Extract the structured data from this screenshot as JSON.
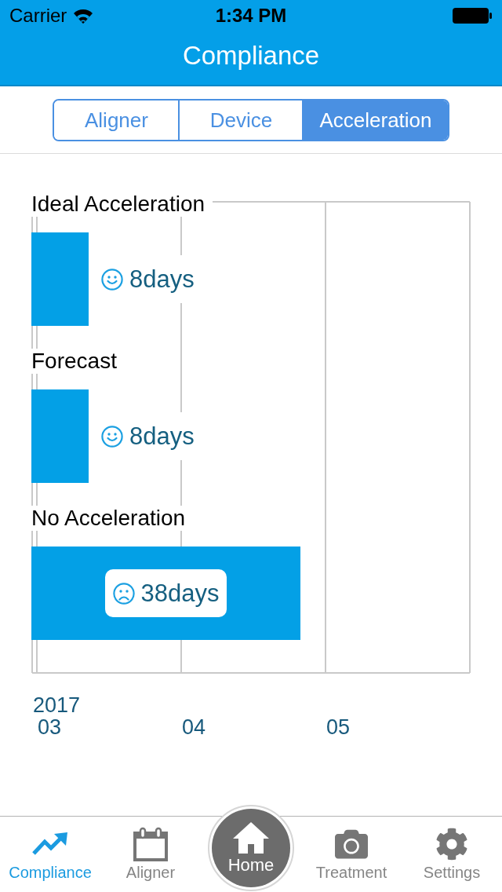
{
  "status_bar": {
    "carrier": "Carrier",
    "time": "1:34 PM"
  },
  "nav_bar": {
    "title": "Compliance"
  },
  "segments": [
    {
      "label": "Aligner",
      "selected": false
    },
    {
      "label": "Device",
      "selected": false
    },
    {
      "label": "Acceleration",
      "selected": true
    }
  ],
  "chart": {
    "chart_data": {
      "type": "bar",
      "orientation": "horizontal",
      "categories": [
        "Ideal Acceleration",
        "Forecast",
        "No Acceleration"
      ],
      "values": [
        8,
        8,
        38
      ],
      "xlim": [
        0,
        62
      ],
      "value_labels": [
        "8days",
        "8days",
        "38days"
      ]
    },
    "badges": [
      {
        "kind": "smile"
      },
      {
        "kind": "smile"
      },
      {
        "kind": "frown"
      }
    ],
    "year_label": "2017",
    "month_labels": [
      "03",
      "04",
      "05"
    ]
  },
  "tab_bar": [
    {
      "label": "Compliance",
      "selected": true,
      "kind": "tab"
    },
    {
      "label": "Aligner",
      "selected": false,
      "kind": "tab"
    },
    {
      "label": "Home",
      "selected": false,
      "kind": "home"
    },
    {
      "label": "Treatment",
      "selected": false,
      "kind": "tab"
    },
    {
      "label": "Settings",
      "selected": false,
      "kind": "tab"
    }
  ]
}
